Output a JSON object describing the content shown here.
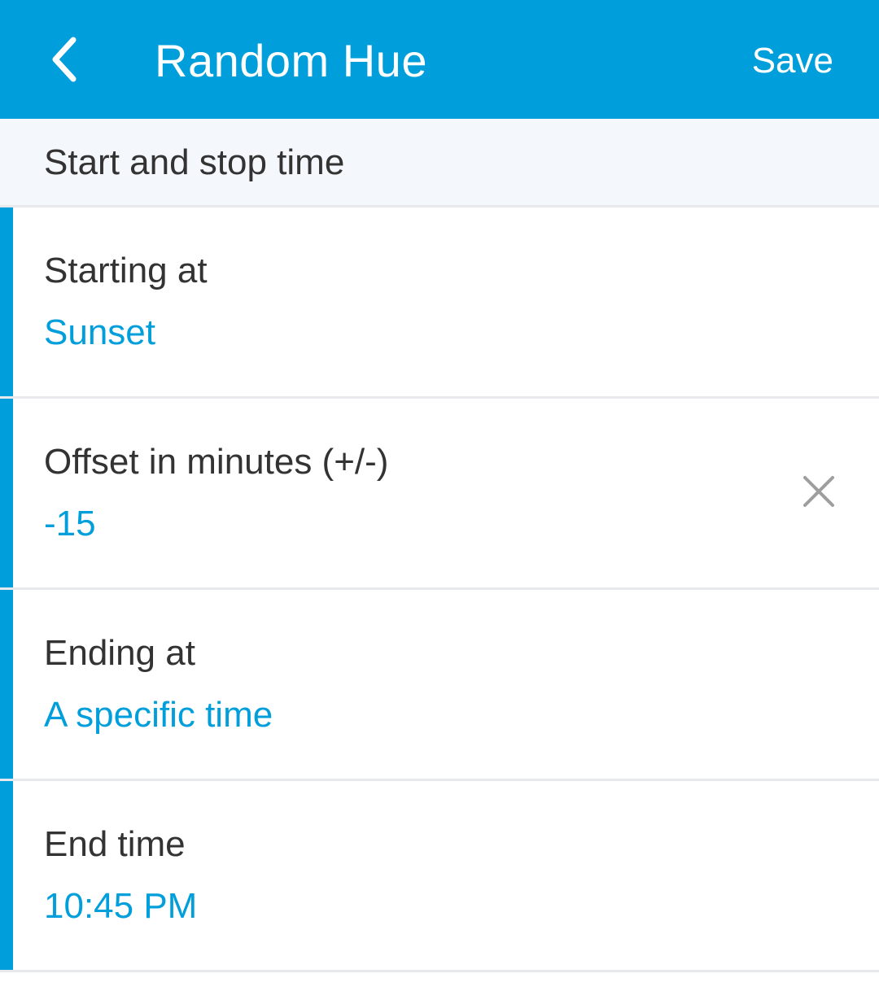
{
  "app_bar": {
    "back_icon": "chevron-left-icon",
    "title": "Random Hue",
    "save_label": "Save",
    "background_color": "#009fdb",
    "text_color": "#ffffff"
  },
  "section": {
    "header": "Start and stop time"
  },
  "rows": [
    {
      "label": "Starting at",
      "value": "Sunset"
    },
    {
      "label": "Offset in minutes (+/-)",
      "value": "-15",
      "action_icon": "close-icon"
    },
    {
      "label": "Ending at",
      "value": "A specific time"
    },
    {
      "label": "End time",
      "value": "10:45 PM"
    }
  ],
  "colors": {
    "accent": "#009fdb",
    "label_text": "#333333",
    "section_background": "#f4f7fb",
    "divider": "#e7e9ec",
    "icon_gray": "#9e9e9e"
  }
}
